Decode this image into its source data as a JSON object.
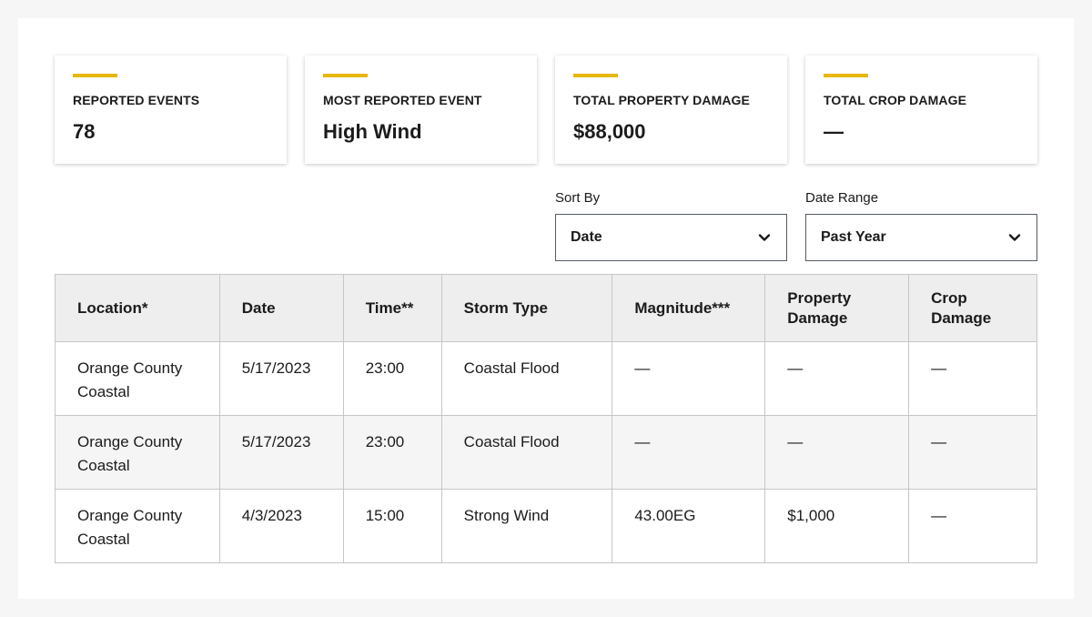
{
  "summary": {
    "cards": [
      {
        "label": "REPORTED EVENTS",
        "value": "78"
      },
      {
        "label": "MOST REPORTED EVENT",
        "value": "High Wind"
      },
      {
        "label": "TOTAL PROPERTY DAMAGE",
        "value": "$88,000"
      },
      {
        "label": "TOTAL CROP DAMAGE",
        "value": "—"
      }
    ],
    "accent_color": "#e5b80b"
  },
  "filters": {
    "sort_by": {
      "label": "Sort By",
      "value": "Date",
      "icon": "chevron-down-icon"
    },
    "date_range": {
      "label": "Date Range",
      "value": "Past Year",
      "icon": "chevron-down-icon"
    }
  },
  "table": {
    "headers": {
      "location": "Location*",
      "date": "Date",
      "time": "Time**",
      "storm_type": "Storm Type",
      "magnitude": "Magnitude***",
      "property_damage": "Property Damage",
      "crop_damage": "Crop Damage"
    },
    "rows": [
      {
        "location": "Orange County Coastal",
        "date": "5/17/2023",
        "time": "23:00",
        "storm_type": "Coastal Flood",
        "magnitude": "—",
        "property_damage": "—",
        "crop_damage": "—"
      },
      {
        "location": "Orange County Coastal",
        "date": "5/17/2023",
        "time": "23:00",
        "storm_type": "Coastal Flood",
        "magnitude": "—",
        "property_damage": "—",
        "crop_damage": "—"
      },
      {
        "location": "Orange County Coastal",
        "date": "4/3/2023",
        "time": "15:00",
        "storm_type": "Strong Wind",
        "magnitude": "43.00EG",
        "property_damage": "$1,000",
        "crop_damage": "—"
      }
    ]
  }
}
